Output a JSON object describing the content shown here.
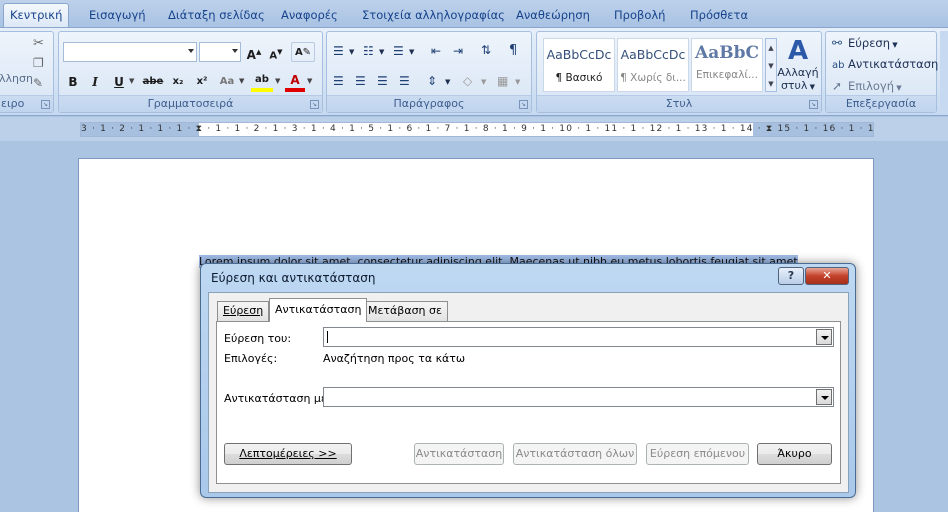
{
  "tabs": [
    {
      "label": "Κεντρική",
      "active": true
    },
    {
      "label": "Εισαγωγή"
    },
    {
      "label": "Διάταξη σελίδας"
    },
    {
      "label": "Αναφορές"
    },
    {
      "label": "Στοιχεία αλληλογραφίας"
    },
    {
      "label": "Αναθεώρηση"
    },
    {
      "label": "Προβολή"
    },
    {
      "label": "Πρόσθετα"
    }
  ],
  "ribbon": {
    "clipboard": {
      "label": "ειρο",
      "paste_partial": "λληση"
    },
    "font": {
      "label": "Γραμματοσειρά",
      "font_name": "",
      "font_size": "",
      "grow": "A",
      "shrink": "A",
      "bold": "B",
      "italic": "I",
      "underline": "U",
      "strike": "abe",
      "subscript": "x₂",
      "superscript": "x²",
      "case": "Aa",
      "highlight": "ab",
      "fontcolor": "A"
    },
    "paragraph": {
      "label": "Παράγραφος"
    },
    "styles": {
      "label": "Στυλ",
      "items": [
        {
          "sample": "AaBbCcDc",
          "name": "¶ Βασικό"
        },
        {
          "sample": "AaBbCcDc",
          "name": "¶ Χωρίς δι..."
        },
        {
          "sample": "AaBbC",
          "name": "Επικεφαλί..."
        }
      ],
      "change_label_1": "Αλλαγή",
      "change_label_2": "στυλ"
    },
    "editing": {
      "label": "Επεξεργασία",
      "find": "Εύρεση",
      "replace": "Αντικατάσταση",
      "select": "Επιλογή"
    }
  },
  "ruler": {
    "numbers": "3 · 1 · 2 · 1 · 1 · 1 · ⧗ · 1 · 1 · 2 · 1 · 3 · 1 · 4 · 1 · 5 · 1 · 6 · 1 · 7 · 1 · 8 · 1 · 9 · 1 · 10 · 1 · 11 · 1 · 12 · 1 · 13 · 1 · 14 · ⧗ 15 · 1 · 16 · 1 · 17 · 1"
  },
  "document": {
    "text": "Lorem ipsum dolor sit amet, consectetur adipiscing elit. Maecenas ut nibh eu metus lobortis feugiat sit amet"
  },
  "dialog": {
    "title": "Εύρεση και αντικατάσταση",
    "help": "?",
    "close": "✕",
    "tabs": {
      "find": "Εύρεση",
      "replace": "Αντικατάσταση",
      "goto": "Μετάβαση σε"
    },
    "find_label": "Εύρεση του:",
    "find_value": "",
    "options_label": "Επιλογές:",
    "options_value": "Αναζήτηση προς τα κάτω",
    "replace_label": "Αντικατάσταση με:",
    "replace_value": "",
    "buttons": {
      "more": "Λεπτομέρειες >>",
      "replace": "Αντικατάσταση",
      "replace_all": "Αντικατάσταση όλων",
      "find_next": "Εύρεση επόμενου",
      "cancel": "Άκυρο"
    }
  }
}
